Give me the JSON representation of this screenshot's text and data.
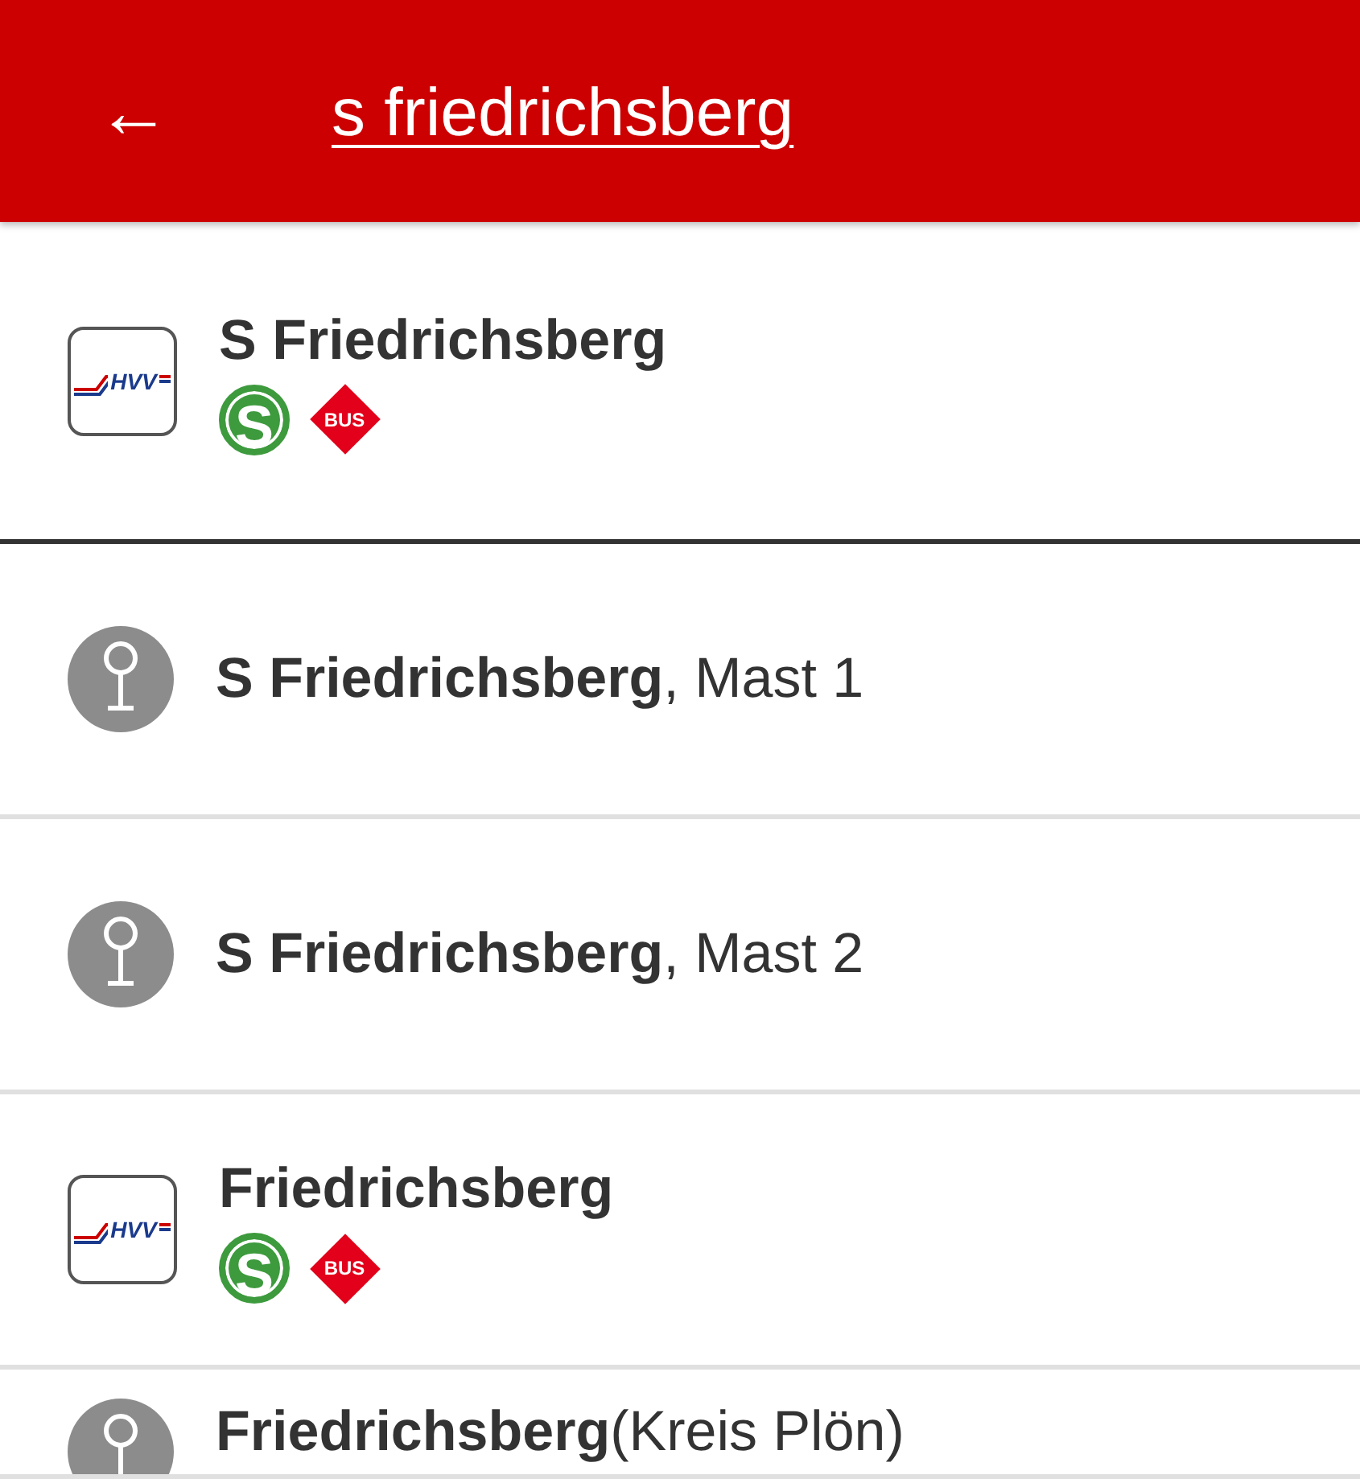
{
  "header": {
    "back_label": "←",
    "search": {
      "value": "s friedrichsberg"
    }
  },
  "results": [
    {
      "kind": "station",
      "selected": true,
      "logo_text": "HVV",
      "name": "S Friedrichsberg",
      "modes": [
        {
          "kind": "s-bahn",
          "label": "S"
        },
        {
          "kind": "bus",
          "label": "BUS"
        }
      ]
    },
    {
      "kind": "stop",
      "selected": false,
      "name": "**S Friedrichsberg**, Mast 1"
    },
    {
      "kind": "stop",
      "selected": false,
      "name": "**S Friedrichsberg**, Mast 2"
    },
    {
      "kind": "station",
      "selected": false,
      "logo_text": "HVV",
      "name": "Friedrichsberg",
      "modes": [
        {
          "kind": "s-bahn",
          "label": "S"
        },
        {
          "kind": "bus",
          "label": "BUS"
        }
      ]
    },
    {
      "kind": "stop",
      "selected": false,
      "name": "**Friedrichsberg**(Kreis Plön)"
    }
  ]
}
